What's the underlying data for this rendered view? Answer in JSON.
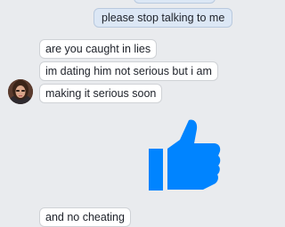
{
  "chat": {
    "outgoing": [
      "please stop talking to me"
    ],
    "incoming": [
      "are you caught in lies",
      "im dating him not serious but i am",
      "making it serious soon",
      "and no cheating"
    ]
  },
  "icons": {
    "like": "thumbs-up-icon",
    "avatar": "contact-avatar"
  },
  "colors": {
    "like_blue": "#0084ff",
    "outgoing_bubble": "#dce7f5",
    "background": "#e9ebee"
  }
}
